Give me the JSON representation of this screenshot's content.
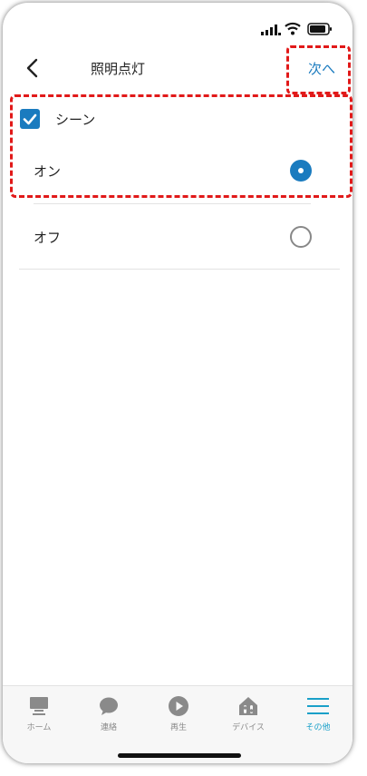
{
  "header": {
    "title": "照明点灯",
    "next_label": "次へ"
  },
  "scene": {
    "label": "シーン",
    "checked": true
  },
  "options": [
    {
      "label": "オン",
      "selected": true
    },
    {
      "label": "オフ",
      "selected": false
    }
  ],
  "tabs": [
    {
      "label": "ホーム",
      "icon": "home-icon",
      "active": false
    },
    {
      "label": "連絡",
      "icon": "chat-bubble-icon",
      "active": false
    },
    {
      "label": "再生",
      "icon": "play-icon",
      "active": false
    },
    {
      "label": "デバイス",
      "icon": "devices-icon",
      "active": false
    },
    {
      "label": "その他",
      "icon": "menu-icon",
      "active": true
    }
  ],
  "colors": {
    "accent": "#1a7bbf",
    "active_tab": "#1aa0c9",
    "highlight": "#e11919"
  }
}
